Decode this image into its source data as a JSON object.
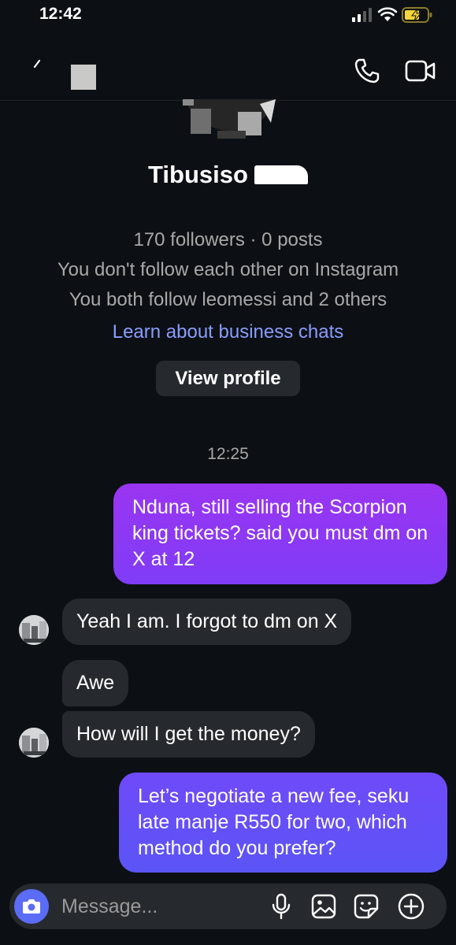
{
  "status_bar": {
    "time": "12:42"
  },
  "profile": {
    "name": "Tibusiso",
    "followers_line": "170 followers · 0 posts",
    "follow_status": "You don't follow each other on Instagram",
    "mutual": "You both follow leomessi and 2 others",
    "learn_link": "Learn about business chats",
    "view_profile_label": "View profile"
  },
  "thread": {
    "timestamp": "12:25",
    "messages": [
      {
        "direction": "outgoing",
        "text": "Nduna, still selling the Scorpion king tickets? said you must dm on X at 12"
      },
      {
        "direction": "incoming",
        "text": "Yeah I am. I forgot to dm on X"
      },
      {
        "direction": "incoming",
        "text": "Awe"
      },
      {
        "direction": "incoming",
        "text": "How will I get the money?"
      },
      {
        "direction": "outgoing",
        "text": "Let’s negotiate a new fee, seku late manje R550 for two, which method do you prefer?"
      }
    ]
  },
  "composer": {
    "placeholder": "Message..."
  },
  "icons": {
    "header": [
      "back-icon",
      "call-icon",
      "video-icon"
    ],
    "composer": [
      "camera-icon",
      "microphone-icon",
      "gallery-icon",
      "sticker-icon",
      "plus-icon"
    ]
  },
  "colors": {
    "background": "#0c1014",
    "outgoing_bubble_top": "#9a35f2",
    "outgoing_bubble_bottom": "#5b55f6",
    "incoming_bubble": "#262a2e",
    "link": "#8a9cff",
    "battery": "#f5d53a"
  }
}
